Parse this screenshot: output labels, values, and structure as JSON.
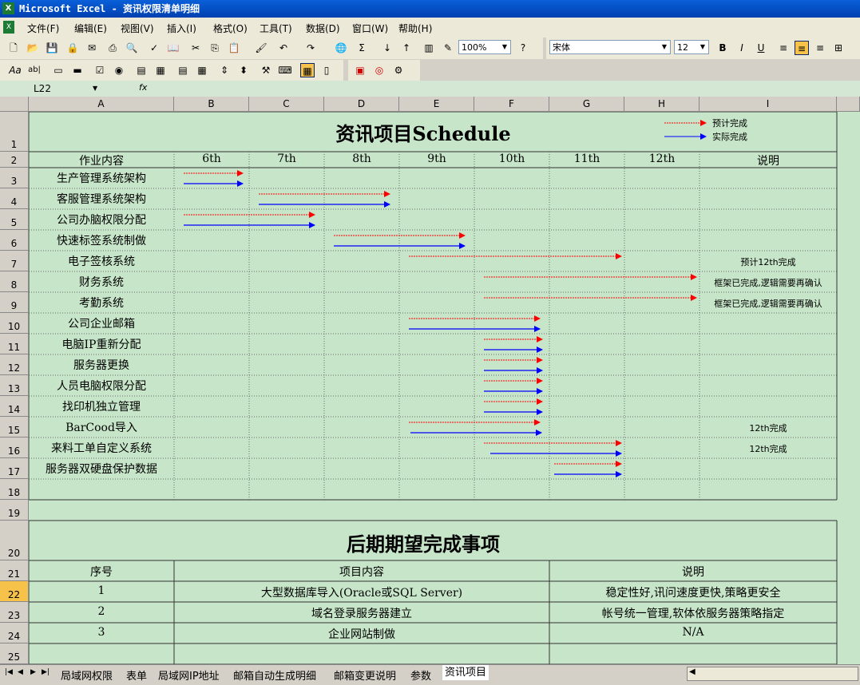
{
  "window": {
    "title": "Microsoft Excel - 资讯权限清单明细"
  },
  "menu": [
    "文件(F)",
    "编辑(E)",
    "视图(V)",
    "插入(I)",
    "格式(O)",
    "工具(T)",
    "数据(D)",
    "窗口(W)",
    "帮助(H)"
  ],
  "toolbar": {
    "zoom": "100%",
    "font": "宋体",
    "font_size": "12",
    "bold": "B",
    "italic": "I",
    "underline": "U"
  },
  "formula_bar": {
    "cell_ref": "L22",
    "fx": "fx"
  },
  "columns": [
    "A",
    "B",
    "C",
    "D",
    "E",
    "F",
    "G",
    "H",
    "I"
  ],
  "rows": [
    "1",
    "2",
    "3",
    "4",
    "5",
    "6",
    "7",
    "8",
    "9",
    "10",
    "11",
    "12",
    "13",
    "14",
    "15",
    "16",
    "17",
    "18",
    "19",
    "20",
    "21",
    "22",
    "23",
    "24",
    "25"
  ],
  "selected_row": "22",
  "schedule": {
    "title": "资讯项目Schedule",
    "legend_planned": "预计完成",
    "legend_actual": "实际完成",
    "planned_color": "#ff0000",
    "actual_color": "#0000ff",
    "header_task": "作业内容",
    "weeks": [
      "6th",
      "7th",
      "8th",
      "9th",
      "10th",
      "11th",
      "12th"
    ],
    "header_note": "说明",
    "tasks": [
      {
        "name": "生产管理系统架构",
        "plan": [
          6,
          6.8
        ],
        "actual": [
          6,
          6.8
        ],
        "note": ""
      },
      {
        "name": "客服管理系统架构",
        "plan": [
          7,
          8.4
        ],
        "actual": [
          7,
          8.4
        ],
        "note": ""
      },
      {
        "name": "公司办脑权限分配",
        "plan": [
          6,
          7.9
        ],
        "actual": [
          6,
          7.9
        ],
        "note": ""
      },
      {
        "name": "快速标签系统制做",
        "plan": [
          8,
          8.9
        ],
        "actual": [
          8,
          8.9
        ],
        "note": ""
      },
      {
        "name": "电子签核系统",
        "plan": [
          9,
          10.9
        ],
        "actual": null,
        "note": "预计12th完成"
      },
      {
        "name": "财务系统",
        "plan": [
          10,
          11.9
        ],
        "actual": null,
        "note": "框架已完成,逻辑需要再确认"
      },
      {
        "name": "考勤系统",
        "plan": [
          10,
          11.9
        ],
        "actual": null,
        "note": "框架已完成,逻辑需要再确认"
      },
      {
        "name": "公司企业邮箱",
        "plan": [
          9,
          9.9
        ],
        "actual": [
          9,
          9.9
        ],
        "note": ""
      },
      {
        "name": "电脑IP重新分配",
        "plan": [
          10,
          9.9
        ],
        "actual": [
          10,
          9.9
        ],
        "note": ""
      },
      {
        "name": "服务器更换",
        "plan": [
          10,
          9.9
        ],
        "actual": [
          10,
          9.9
        ],
        "note": ""
      },
      {
        "name": "人员电脑权限分配",
        "plan": [
          10,
          9.9
        ],
        "actual": [
          10,
          9.9
        ],
        "note": ""
      },
      {
        "name": "找印机独立管理",
        "plan": [
          10,
          9.9
        ],
        "actual": [
          10,
          9.9
        ],
        "note": ""
      },
      {
        "name": "BarCood导入",
        "plan": [
          9,
          9.9
        ],
        "actual": [
          9,
          9.9
        ],
        "note": "12th完成"
      },
      {
        "name": "来料工单自定义系统",
        "plan": [
          10,
          10.9
        ],
        "actual": [
          10,
          10.9
        ],
        "note": "12th完成"
      },
      {
        "name": "服务器双硬盘保护数据",
        "plan": [
          11,
          10.9
        ],
        "actual": [
          11,
          10.9
        ],
        "note": ""
      }
    ]
  },
  "future": {
    "title": "后期期望完成事项",
    "headers": [
      "序号",
      "项目内容",
      "说明"
    ],
    "items": [
      {
        "no": "1",
        "content": "大型数据库导入(Oracle或SQL Server)",
        "note": "稳定性好,讯问速度更快,策略更安全"
      },
      {
        "no": "2",
        "content": "域名登录服务器建立",
        "note": "帐号统一管理,软体依服务器策略指定"
      },
      {
        "no": "3",
        "content": "企业网站制做",
        "note": "N/A"
      }
    ]
  },
  "sheet_tabs": [
    "局域网权限",
    "表单",
    "局域网IP地址",
    "邮箱自动生成明细",
    "邮箱变更说明",
    "参数",
    "资讯项目"
  ],
  "active_tab": "资讯项目"
}
